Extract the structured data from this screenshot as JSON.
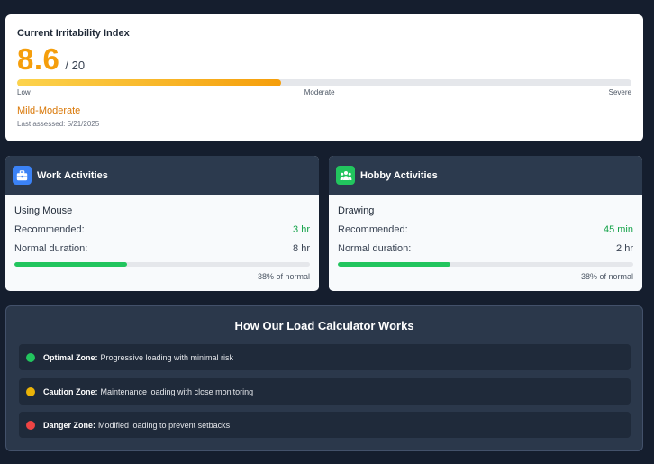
{
  "irritability": {
    "title": "Current Irritability Index",
    "score": "8.6",
    "max": "/ 20",
    "progress_fraction": 0.43,
    "scale": {
      "low": "Low",
      "mid": "Moderate",
      "high": "Severe"
    },
    "level": "Mild-Moderate",
    "assessed": "Last assessed: 5/21/2025"
  },
  "work": {
    "heading": "Work Activities",
    "icon": "briefcase-icon",
    "activity": "Using Mouse",
    "recommended_label": "Recommended:",
    "recommended_value": "3 hr",
    "normal_label": "Normal duration:",
    "normal_value": "8 hr",
    "progress_fraction": 0.38,
    "percent_text": "38% of normal"
  },
  "hobby": {
    "heading": "Hobby Activities",
    "icon": "people-icon",
    "activity": "Drawing",
    "recommended_label": "Recommended:",
    "recommended_value": "45 min",
    "normal_label": "Normal duration:",
    "normal_value": "2 hr",
    "progress_fraction": 0.38,
    "percent_text": "38% of normal"
  },
  "calculator": {
    "title": "How Our Load Calculator Works",
    "zones": [
      {
        "label": "Optimal Zone:",
        "desc": "Progressive loading with minimal risk",
        "color": "#22c55e"
      },
      {
        "label": "Caution Zone:",
        "desc": "Maintenance loading with close monitoring",
        "color": "#eab308"
      },
      {
        "label": "Danger Zone:",
        "desc": "Modified loading to prevent setbacks",
        "color": "#ef4444"
      }
    ]
  },
  "colors": {
    "background": "#151e2e",
    "accent_orange": "#f59e0b",
    "success_green": "#22c55e",
    "work_icon_blue": "#3b82f6"
  }
}
